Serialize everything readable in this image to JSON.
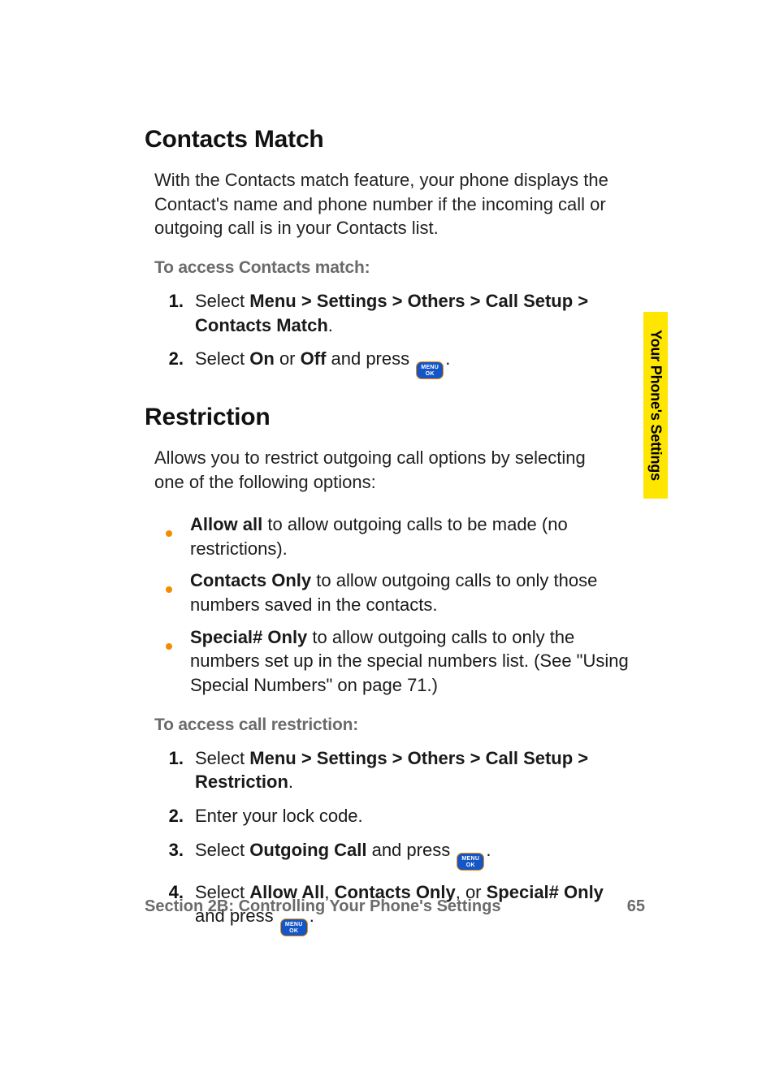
{
  "sideTab": "Your Phone's Settings",
  "sections": {
    "contactsMatch": {
      "heading": "Contacts Match",
      "intro": "With the Contacts match feature, your phone displays the Contact's name and phone number if the incoming call or outgoing call is in your Contacts list.",
      "subhead": "To access Contacts match:",
      "steps": {
        "s1": {
          "marker": "1.",
          "pre": "Select ",
          "bold": "Menu > Settings > Others > Call Setup > Contacts Match",
          "post": "."
        },
        "s2": {
          "marker": "2.",
          "pre": "Select ",
          "b1": "On",
          "mid1": " or ",
          "b2": "Off",
          "mid2": " and press ",
          "btnTop": "MENU",
          "btnBot": "OK",
          "post": "."
        }
      }
    },
    "restriction": {
      "heading": "Restriction",
      "intro": "Allows you to restrict outgoing call options by selecting one of the following options:",
      "bullets": {
        "b1": {
          "bold": "Allow all",
          "rest": " to allow outgoing calls to be made (no restrictions)."
        },
        "b2": {
          "bold": "Contacts Only",
          "rest": " to allow outgoing calls to only those numbers saved in the contacts."
        },
        "b3": {
          "bold": "Special# Only",
          "rest": " to allow outgoing calls to only the numbers set up in the special numbers list. (See \"Using Special Numbers\" on page 71.)"
        }
      },
      "subhead": "To access call restriction:",
      "steps": {
        "s1": {
          "marker": "1.",
          "pre": "Select ",
          "bold": "Menu > Settings > Others > Call Setup > Restriction",
          "post": "."
        },
        "s2": {
          "marker": "2.",
          "text": "Enter your lock code."
        },
        "s3": {
          "marker": "3.",
          "pre": "Select ",
          "b1": "Outgoing Call",
          "mid": " and press ",
          "btnTop": "MENU",
          "btnBot": "OK",
          "post": "."
        },
        "s4": {
          "marker": "4.",
          "pre": "Select ",
          "b1": "Allow All",
          "c1": ", ",
          "b2": "Contacts Only",
          "c2": ", or ",
          "b3": "Special# Only",
          "mid": " and press ",
          "btnTop": "MENU",
          "btnBot": "OK",
          "post": "."
        }
      }
    }
  },
  "footer": {
    "left": "Section 2B: Controlling Your Phone's Settings",
    "page": "65"
  }
}
